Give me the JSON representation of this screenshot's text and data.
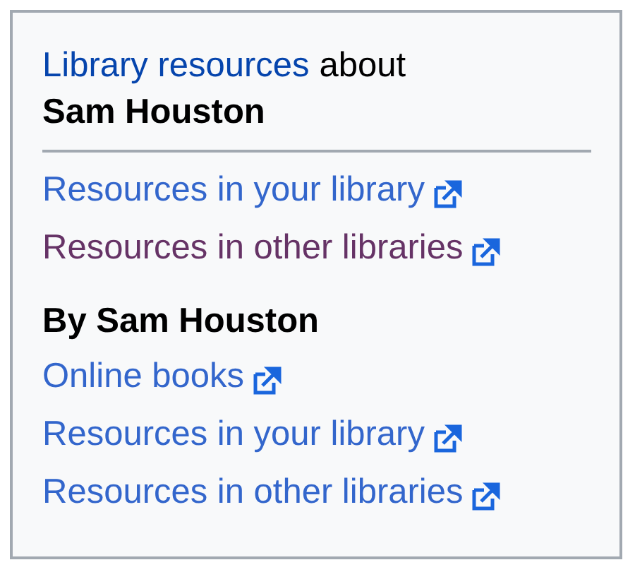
{
  "header": {
    "link": "Library resources",
    "text": "about",
    "subject": "Sam Houston"
  },
  "about_links": [
    {
      "label": "Resources in your library",
      "visited": false
    },
    {
      "label": "Resources in other libraries",
      "visited": true
    }
  ],
  "by_section": {
    "heading": "By Sam Houston",
    "links": [
      {
        "label": "Online books",
        "visited": false
      },
      {
        "label": "Resources in your library",
        "visited": false
      },
      {
        "label": "Resources in other libraries",
        "visited": false
      }
    ]
  }
}
